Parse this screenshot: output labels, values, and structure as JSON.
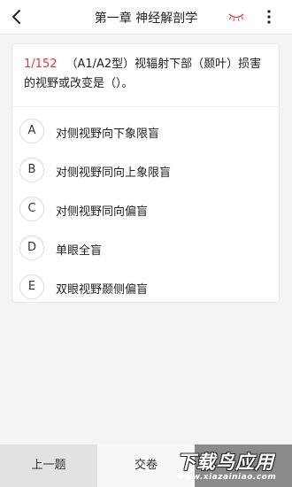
{
  "header": {
    "title": "第一章 神经解剖学",
    "back_icon": "chevron-left-icon",
    "eye_icon": "eye-closed-icon",
    "more_icon": "more-vertical-icon",
    "eye_color": "#e53935"
  },
  "question": {
    "number": "1/152",
    "text": "（A1/A2型）视辐射下部（颞叶）损害的视野或改变是（）。"
  },
  "options": [
    {
      "letter": "A",
      "text": "对侧视野向下象限盲"
    },
    {
      "letter": "B",
      "text": "对侧视野同向上象限盲"
    },
    {
      "letter": "C",
      "text": "对侧视野同向偏盲"
    },
    {
      "letter": "D",
      "text": "单眼全盲"
    },
    {
      "letter": "E",
      "text": "双眼视野颞侧偏盲"
    }
  ],
  "footer": {
    "prev_label": "上一题",
    "submit_label": "交卷"
  },
  "watermark": {
    "main": "下载鸟应用",
    "sub": "www.xiazainiao.com"
  }
}
